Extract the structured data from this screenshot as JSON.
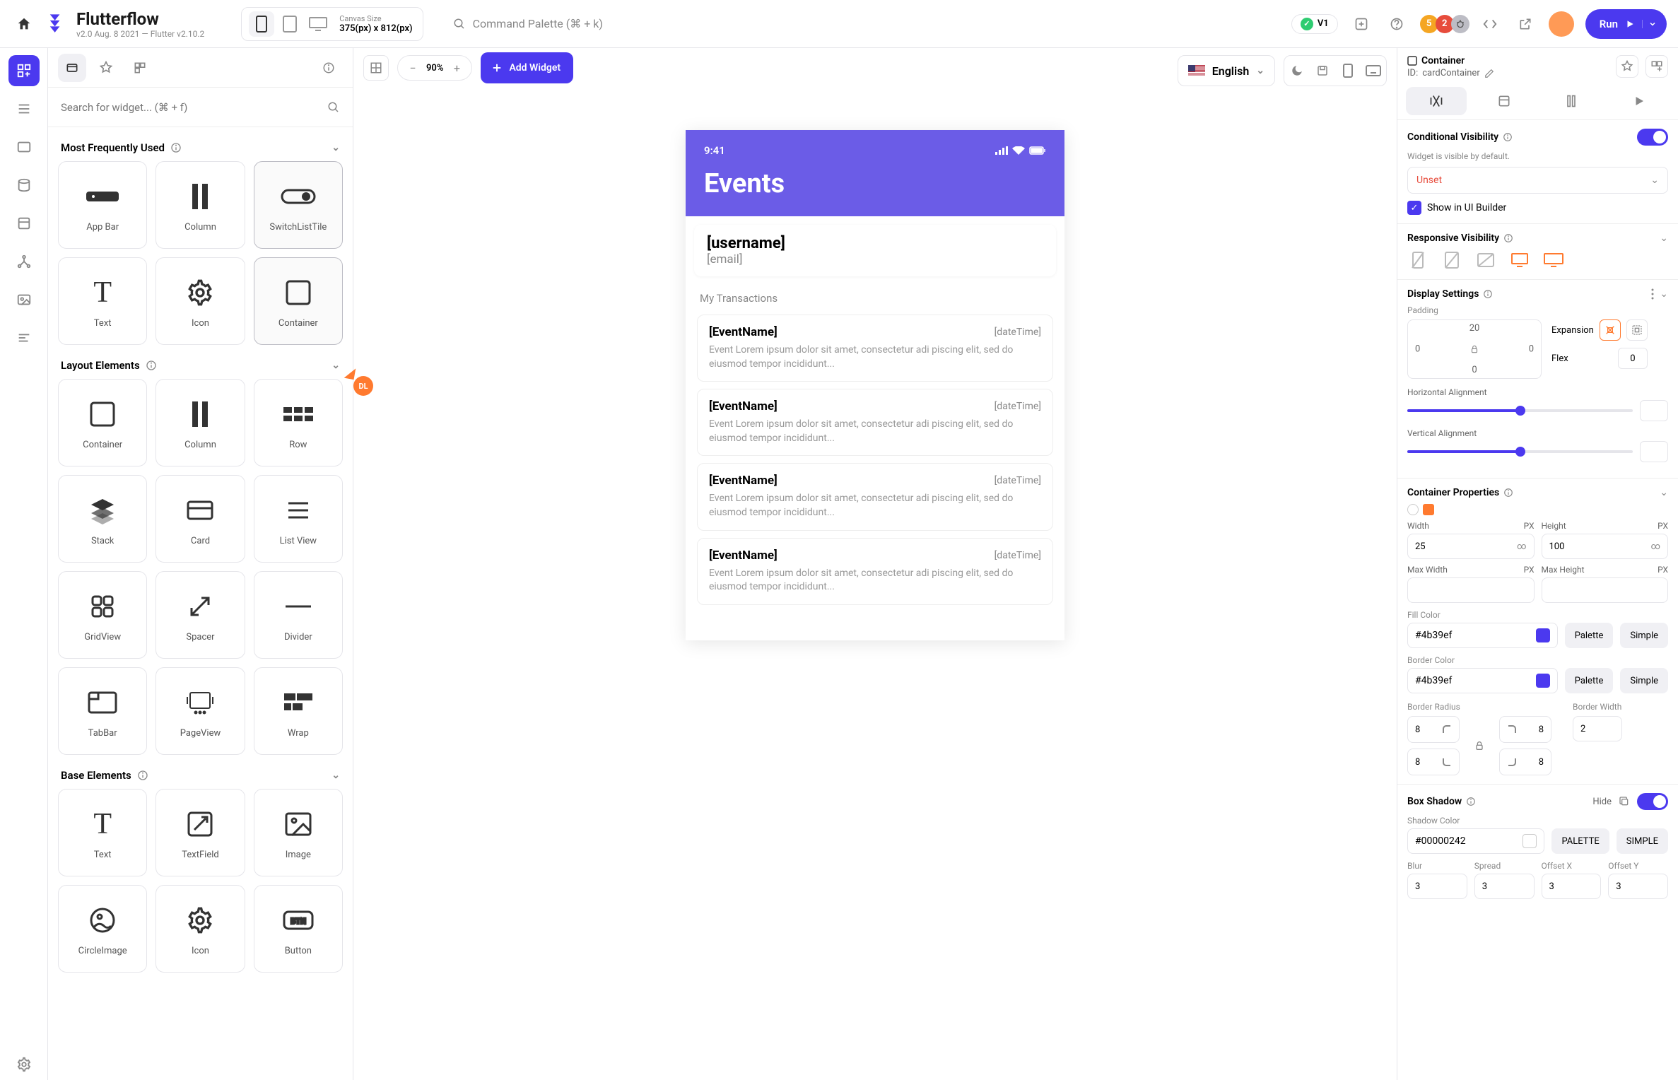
{
  "top": {
    "brand": "Flutterflow",
    "version_line": "v2.0 Aug. 8 2021 — Flutter v2.10.2",
    "canvas_size_label": "Canvas Size",
    "canvas_size_value": "375(px) x 812(px)",
    "command_palette": "Command Palette (⌘ + k)",
    "version_pill": "V1",
    "badges": {
      "orange": "5",
      "red": "2"
    },
    "run": "Run"
  },
  "palette": {
    "search_placeholder": "Search for widget... (⌘ + f)",
    "sections": {
      "mfu": {
        "title": "Most Frequently Used",
        "items": [
          "App Bar",
          "Column",
          "SwitchListTile",
          "Text",
          "Icon",
          "Container"
        ]
      },
      "layout": {
        "title": "Layout Elements",
        "items": [
          "Container",
          "Column",
          "Row",
          "Stack",
          "Card",
          "List View",
          "GridView",
          "Spacer",
          "Divider",
          "TabBar",
          "PageView",
          "Wrap"
        ]
      },
      "base": {
        "title": "Base Elements",
        "items": [
          "Text",
          "TextField",
          "Image",
          "CircleImage",
          "Icon",
          "Button"
        ]
      }
    }
  },
  "canvas": {
    "zoom": "90%",
    "add_widget": "Add Widget",
    "language": "English",
    "collaborator": "DL"
  },
  "phone": {
    "time": "9:41",
    "title": "Events",
    "username": "[username]",
    "email": "[email]",
    "section_label": "My Transactions",
    "events": [
      {
        "name": "[EventName]",
        "time": "[dateTime]",
        "desc": "Event Lorem ipsum dolor sit amet, consectetur adi piscing elit, sed do eiusmod tempor incididunt..."
      },
      {
        "name": "[EventName]",
        "time": "[dateTime]",
        "desc": "Event Lorem ipsum dolor sit amet, consectetur adi piscing elit, sed do eiusmod tempor incididunt..."
      },
      {
        "name": "[EventName]",
        "time": "[dateTime]",
        "desc": "Event Lorem ipsum dolor sit amet, consectetur adi piscing elit, sed do eiusmod tempor incididunt..."
      },
      {
        "name": "[EventName]",
        "time": "[dateTime]",
        "desc": "Event Lorem ipsum dolor sit amet, consectetur adi piscing elit, sed do eiusmod tempor incididunt..."
      }
    ]
  },
  "inspector": {
    "widget_type": "Container",
    "widget_id_label": "ID:",
    "widget_id": "cardContainer",
    "cond_vis": {
      "title": "Conditional Visibility",
      "hint": "Widget is visible by default.",
      "select": "Unset",
      "show_ui": "Show in UI Builder"
    },
    "resp_vis": {
      "title": "Responsive Visibility"
    },
    "display": {
      "title": "Display Settings",
      "padding_label": "Padding",
      "padding": {
        "top": "20",
        "right": "0",
        "bottom": "0",
        "left": "0"
      },
      "expansion_label": "Expansion",
      "flex_label": "Flex",
      "flex_value": "0",
      "h_align": "Horizontal Alignment",
      "v_align": "Vertical Alignment"
    },
    "container": {
      "title": "Container Properties",
      "width_label": "Width",
      "width_val": "25",
      "width_unit": "PX",
      "height_label": "Height",
      "height_val": "100",
      "height_unit": "PX",
      "max_width_label": "Max Width",
      "max_height_label": "Max Height",
      "fill_label": "Fill Color",
      "fill_val": "#4b39ef",
      "border_color_label": "Border Color",
      "border_color_val": "#4b39ef",
      "palette_btn": "Palette",
      "simple_btn": "Simple",
      "radius_label": "Border Radius",
      "radius": {
        "tl": "8",
        "tr": "8",
        "bl": "8",
        "br": "8"
      },
      "border_width_label": "Border Width",
      "border_width": "2"
    },
    "shadow": {
      "title": "Box Shadow",
      "hide_label": "Hide",
      "color_label": "Shadow Color",
      "color_val": "#00000242",
      "palette_btn": "PALETTE",
      "simple_btn": "SIMPLE",
      "blur_label": "Blur",
      "blur": "3",
      "spread_label": "Spread",
      "spread": "3",
      "offx_label": "Offset X",
      "offx": "3",
      "offy_label": "Offset Y",
      "offy": "3"
    }
  }
}
